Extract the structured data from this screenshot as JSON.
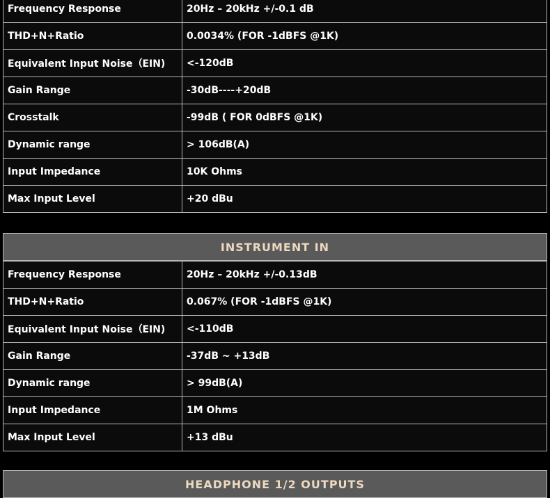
{
  "top_table": {
    "rows": [
      {
        "label": "Frequency Response",
        "value": "20Hz – 20kHz +/-0.1 dB"
      },
      {
        "label": "THD+N+Ratio",
        "value": "0.0034% (FOR -1dBFS @1K)"
      },
      {
        "label": "Equivalent Input Noise（EIN)",
        "value": "<-120dB"
      },
      {
        "label": "Gain Range",
        "value": "-30dB----+20dB"
      },
      {
        "label": "Crosstalk",
        "value": "-99dB ( FOR 0dBFS @1K)"
      },
      {
        "label": "Dynamic range",
        "value": "> 106dB(A)"
      },
      {
        "label": "Input Impedance",
        "value": "10K Ohms"
      },
      {
        "label": "Max Input Level",
        "value": "+20 dBu"
      }
    ]
  },
  "instrument_section": {
    "title": "INSTRUMENT IN",
    "rows": [
      {
        "label": "Frequency Response",
        "value": "20Hz – 20kHz +/-0.13dB"
      },
      {
        "label": "THD+N+Ratio",
        "value": "0.067% (FOR -1dBFS @1K)"
      },
      {
        "label": "Equivalent Input Noise（EIN)",
        "value": "<-110dB"
      },
      {
        "label": "Gain Range",
        "value": "-37dB ~ +13dB"
      },
      {
        "label": "Dynamic range",
        "value": "> 99dB(A)"
      },
      {
        "label": "Input Impedance",
        "value": "1M Ohms"
      },
      {
        "label": "Max Input Level",
        "value": "+13 dBu"
      }
    ]
  },
  "headphone_section": {
    "title": "HEADPHONE 1/2 OUTPUTS"
  },
  "colors": {
    "background": "#000000",
    "cell_background": "#0b0b0b",
    "border": "#b7b7b7",
    "header_background": "#5a5a5a",
    "header_text": "#ecd9bf"
  }
}
